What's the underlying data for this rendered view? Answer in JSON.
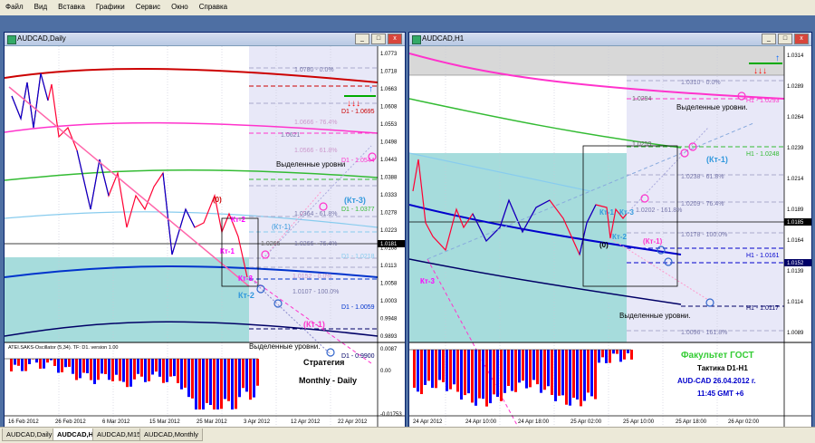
{
  "menu": [
    "Файл",
    "Вид",
    "Вставка",
    "Графики",
    "Сервис",
    "Окно",
    "Справка"
  ],
  "left": {
    "title": "AUDCAD,Daily",
    "price_scale": [
      "1.0773",
      "1.0718",
      "1.0663",
      "1.0608",
      "1.0553",
      "1.0498",
      "1.0443",
      "1.0388",
      "1.0333",
      "1.0278",
      "1.0223",
      "1.0168",
      "1.0113",
      "1.0058",
      "1.0003",
      "0.9948",
      "0.9893"
    ],
    "current_price": "1.0181",
    "levels": [
      "1.0780 - 0.0%",
      "D1 - 1.0695",
      "1.0666 - 76.4%",
      "1.0621",
      "1.0566 - 61.8%",
      "D1 - 1.0544",
      "1.0364 - 61.8%",
      "D1 - 1.0377",
      "1.0266 - 76.4%",
      "1.0266",
      "D1 - 1.0218",
      "1.0152 - 0.0%",
      "1.0107 - 100.0%",
      "D1 - 1.0059",
      "D1 - 0.9900"
    ],
    "labels": {
      "vydel1": "Выделенные уровни",
      "vydel2": "Выделенные уровни.",
      "kt3": "(Кт-3)",
      "kt1a": "(Кт-1)",
      "kt1b": "(Кт-1)",
      "ktt2": "Кт-2",
      "ktt1": "Кт-1",
      "ktt3": "Кт-3",
      "ktt2b": "Кт-2",
      "zero": "(0)"
    },
    "osc_title": "ATEI.SAKS-Oscillator (5,34). TF: D1. version 1.00",
    "osc_scale": [
      "0.0087",
      "0.00",
      "-0.01753"
    ],
    "strategy1": "Стратегия",
    "strategy2": "Monthly - Daily",
    "dates": [
      "16 Feb 2012",
      "26 Feb 2012",
      "6 Mar 2012",
      "15 Mar 2012",
      "25 Mar 2012",
      "3 Apr 2012",
      "12 Apr 2012",
      "22 Apr 2012"
    ]
  },
  "right": {
    "title": "AUDCAD,H1",
    "price_scale": [
      "1.0314",
      "1.0289",
      "1.0264",
      "1.0239",
      "1.0214",
      "1.0189",
      "1.0164",
      "1.0139",
      "1.0114",
      "1.0089"
    ],
    "current_price": "1.0185",
    "current_price2": "1.0152",
    "levels": [
      "1.0310 - 0.0%",
      "H1 - 1.0293",
      "1.0294",
      "1.0259",
      "H1 - 1.0248",
      "1.0238 - 61.8%",
      "1.0209 - 76.4%",
      "1.0202 - 161.8%",
      "1.0178 - 100.0%",
      "H1 - 1.0161",
      "H1 - 1.0117",
      "1.0096 - 161.8%"
    ],
    "labels": {
      "vydel1": "Выделенные уровни.",
      "vydel2": "Выделенные уровни.",
      "kt1a": "(Кт-1)",
      "kt1b": "(Кт-1)",
      "ktt1": "Кт-1",
      "ktt2": "Кт-2",
      "ktt3": "Кт-3",
      "ktt3b": "Кт-3",
      "zero": "(0)"
    },
    "faculty": "Факультет ГОСТ",
    "tactic": "Тактика  D1-H1",
    "pair_date": "AUD-CAD  26.04.2012 г.",
    "time": "11:45  GMT +6",
    "dates": [
      "24 Apr 2012",
      "24 Apr 10:00",
      "24 Apr 18:00",
      "25 Apr 02:00",
      "25 Apr 10:00",
      "25 Apr 18:00",
      "26 Apr 02:00"
    ]
  },
  "tabs": [
    "AUDCAD,Daily",
    "AUDCAD,H1",
    "AUDCAD,M15",
    "AUDCAD,Monthly"
  ],
  "active_tab": 1,
  "colors": {
    "accent": "#ff00ff",
    "blue": "#0000cc",
    "red": "#ff0000",
    "cyan_zone": "#a6dcdc",
    "lavender_zone": "#e8e8f8"
  }
}
